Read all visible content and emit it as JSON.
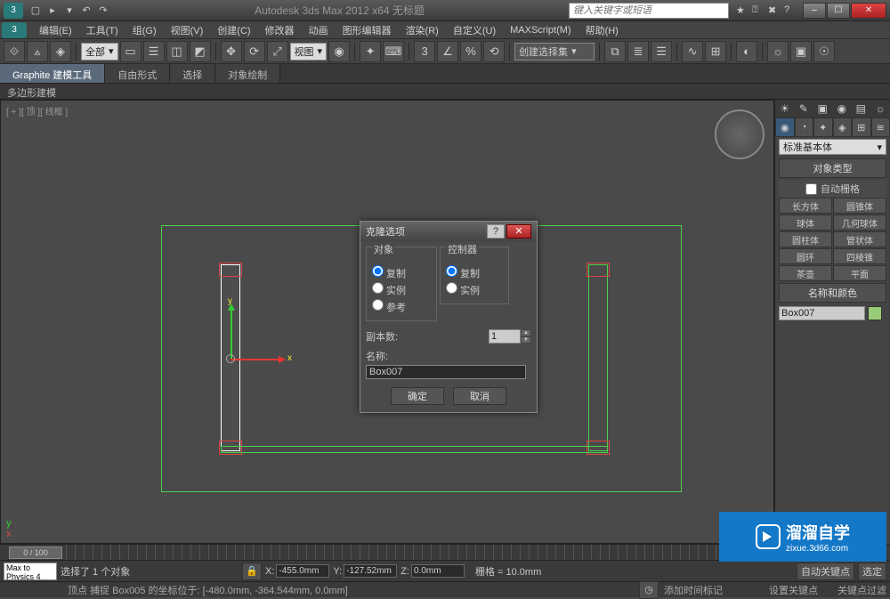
{
  "app": {
    "title": "Autodesk 3ds Max 2012 x64    无标题",
    "search_placeholder": "键入关键字或短语",
    "app_icon_label": "3"
  },
  "menubar": {
    "items": [
      "编辑(E)",
      "工具(T)",
      "组(G)",
      "视图(V)",
      "创建(C)",
      "修改器",
      "动画",
      "图形编辑器",
      "渲染(R)",
      "自定义(U)",
      "MAXScript(M)",
      "帮助(H)"
    ]
  },
  "toolbar": {
    "dropdown_all": "全部",
    "dropdown_view": "视图",
    "dropdown_selset": "创建选择集"
  },
  "ribbon": {
    "tabs": [
      "Graphite 建模工具",
      "自由形式",
      "选择",
      "对象绘制"
    ],
    "sub": "多边形建模"
  },
  "viewport": {
    "label": "[ + ][ 顶 ][ 线框 ]",
    "corner_x": "x",
    "corner_y": "y",
    "gizmo_x": "x",
    "gizmo_y": "y"
  },
  "cmd_panel": {
    "dropdown": "标准基本体",
    "rollout_type": "对象类型",
    "auto_grid": "自动栅格",
    "primitives": [
      "长方体",
      "圆锥体",
      "球体",
      "几何球体",
      "圆柱体",
      "管状体",
      "圆环",
      "四棱锥",
      "茶壶",
      "平面"
    ],
    "rollout_name": "名称和颜色",
    "name_value": "Box007"
  },
  "dialog": {
    "title": "克隆选项",
    "group_object": "对象",
    "obj_options": [
      "复制",
      "实例",
      "参考"
    ],
    "group_controller": "控制器",
    "ctrl_options": [
      "复制",
      "实例"
    ],
    "copies_label": "副本数:",
    "copies_value": "1",
    "name_label": "名称:",
    "name_value": "Box007",
    "ok": "确定",
    "cancel": "取消"
  },
  "timeline": {
    "handle": "0 / 100"
  },
  "statusbar": {
    "script_input": "Max to Physics 4",
    "selection": "选择了 1 个对象",
    "snap_info": "顶点 捕捉 Box005 的坐标位于:  [-480.0mm, -364.544mm, 0.0mm]",
    "x_label": "X:",
    "x_value": "-455.0mm",
    "y_label": "Y:",
    "y_value": "-127.52mm",
    "z_label": "Z:",
    "z_value": "0.0mm",
    "grid_label": "栅格 = 10.0mm",
    "auto_key": "自动关键点",
    "sel_label": "选定",
    "set_key": "设置关键点",
    "key_filter": "关键点过滤",
    "add_time_tag": "添加时间标记"
  },
  "watermark": {
    "text_big": "溜溜自学",
    "text_small": "zixue.3d66.com"
  }
}
